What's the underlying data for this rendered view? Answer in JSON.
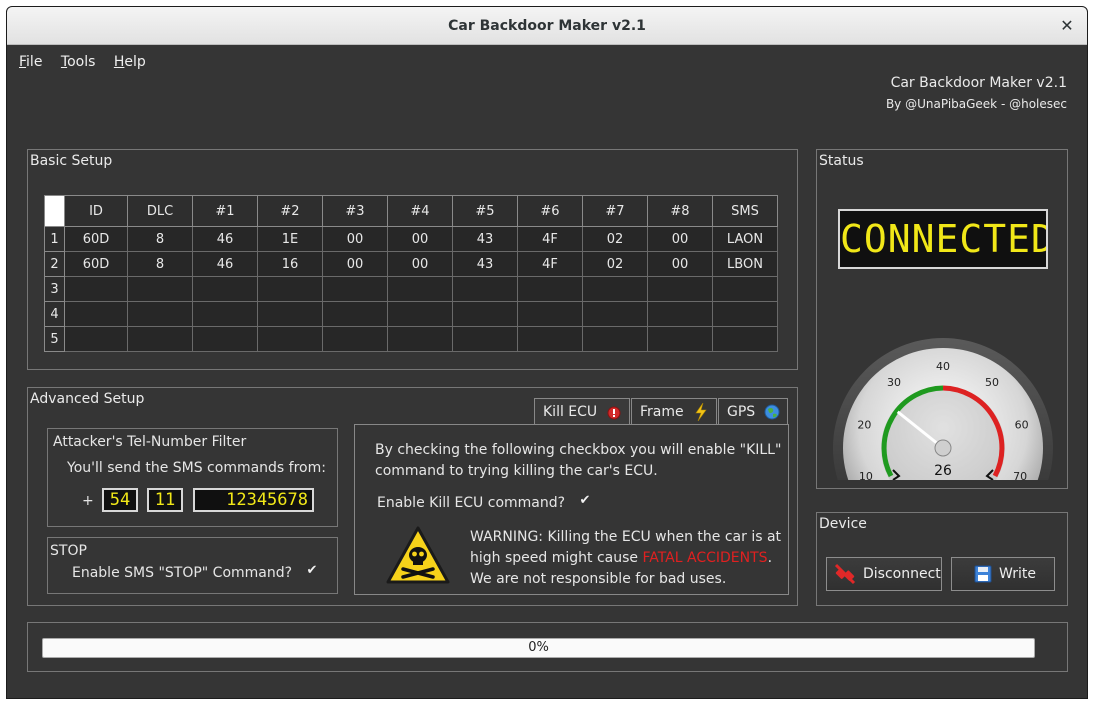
{
  "window": {
    "title": "Car Backdoor Maker v2.1"
  },
  "menu": {
    "file": "File",
    "tools": "Tools",
    "help": "Help"
  },
  "header": {
    "title": "Car Backdoor Maker v2.1",
    "byline": "By @UnaPibaGeek - @holesec"
  },
  "basic_setup": {
    "title": "Basic Setup",
    "columns": [
      "ID",
      "DLC",
      "#1",
      "#2",
      "#3",
      "#4",
      "#5",
      "#6",
      "#7",
      "#8",
      "SMS"
    ],
    "row_numbers": [
      "1",
      "2",
      "3",
      "4",
      "5"
    ],
    "rows": [
      [
        "60D",
        "8",
        "46",
        "1E",
        "00",
        "00",
        "43",
        "4F",
        "02",
        "00",
        "LAON"
      ],
      [
        "60D",
        "8",
        "46",
        "16",
        "00",
        "00",
        "43",
        "4F",
        "02",
        "00",
        "LBON"
      ],
      [
        "",
        "",
        "",
        "",
        "",
        "",
        "",
        "",
        "",
        "",
        ""
      ],
      [
        "",
        "",
        "",
        "",
        "",
        "",
        "",
        "",
        "",
        "",
        ""
      ],
      [
        "",
        "",
        "",
        "",
        "",
        "",
        "",
        "",
        "",
        "",
        ""
      ]
    ]
  },
  "status": {
    "title": "Status",
    "lcd": "CONNECTED",
    "gauge": {
      "ticks": [
        "10",
        "20",
        "30",
        "40",
        "50",
        "60",
        "70"
      ],
      "value_label": "26",
      "value": 26
    }
  },
  "advanced_setup": {
    "title": "Advanced Setup",
    "tel_filter": {
      "title": "Attacker's Tel-Number Filter",
      "description": "You'll send the SMS commands from:",
      "plus": "+",
      "country": "54",
      "area": "11",
      "number": "12345678"
    },
    "stop": {
      "title": "STOP",
      "checkbox_label": "Enable SMS \"STOP\" Command?"
    },
    "tabs": [
      "Kill ECU",
      "Frame",
      "GPS"
    ],
    "kill_ecu": {
      "line1": "By checking the following checkbox you will enable \"KILL\"",
      "line2": "command to trying killing the car's ECU.",
      "checkbox_label": "Enable Kill ECU command?",
      "warn1": "WARNING: Killing the ECU when the car is at",
      "warn2_pre": "high speed might cause ",
      "warn2_red": "FATAL ACCIDENTS",
      "warn2_post": ".",
      "warn3": "We are not responsible for bad uses."
    }
  },
  "device": {
    "title": "Device",
    "disconnect": "Disconnect",
    "write": "Write"
  },
  "progress": {
    "label": "0%",
    "value": 0
  },
  "colors": {
    "lcd_text": "#f1e718",
    "warning_red": "#e02020",
    "window_bg": "#353535"
  }
}
